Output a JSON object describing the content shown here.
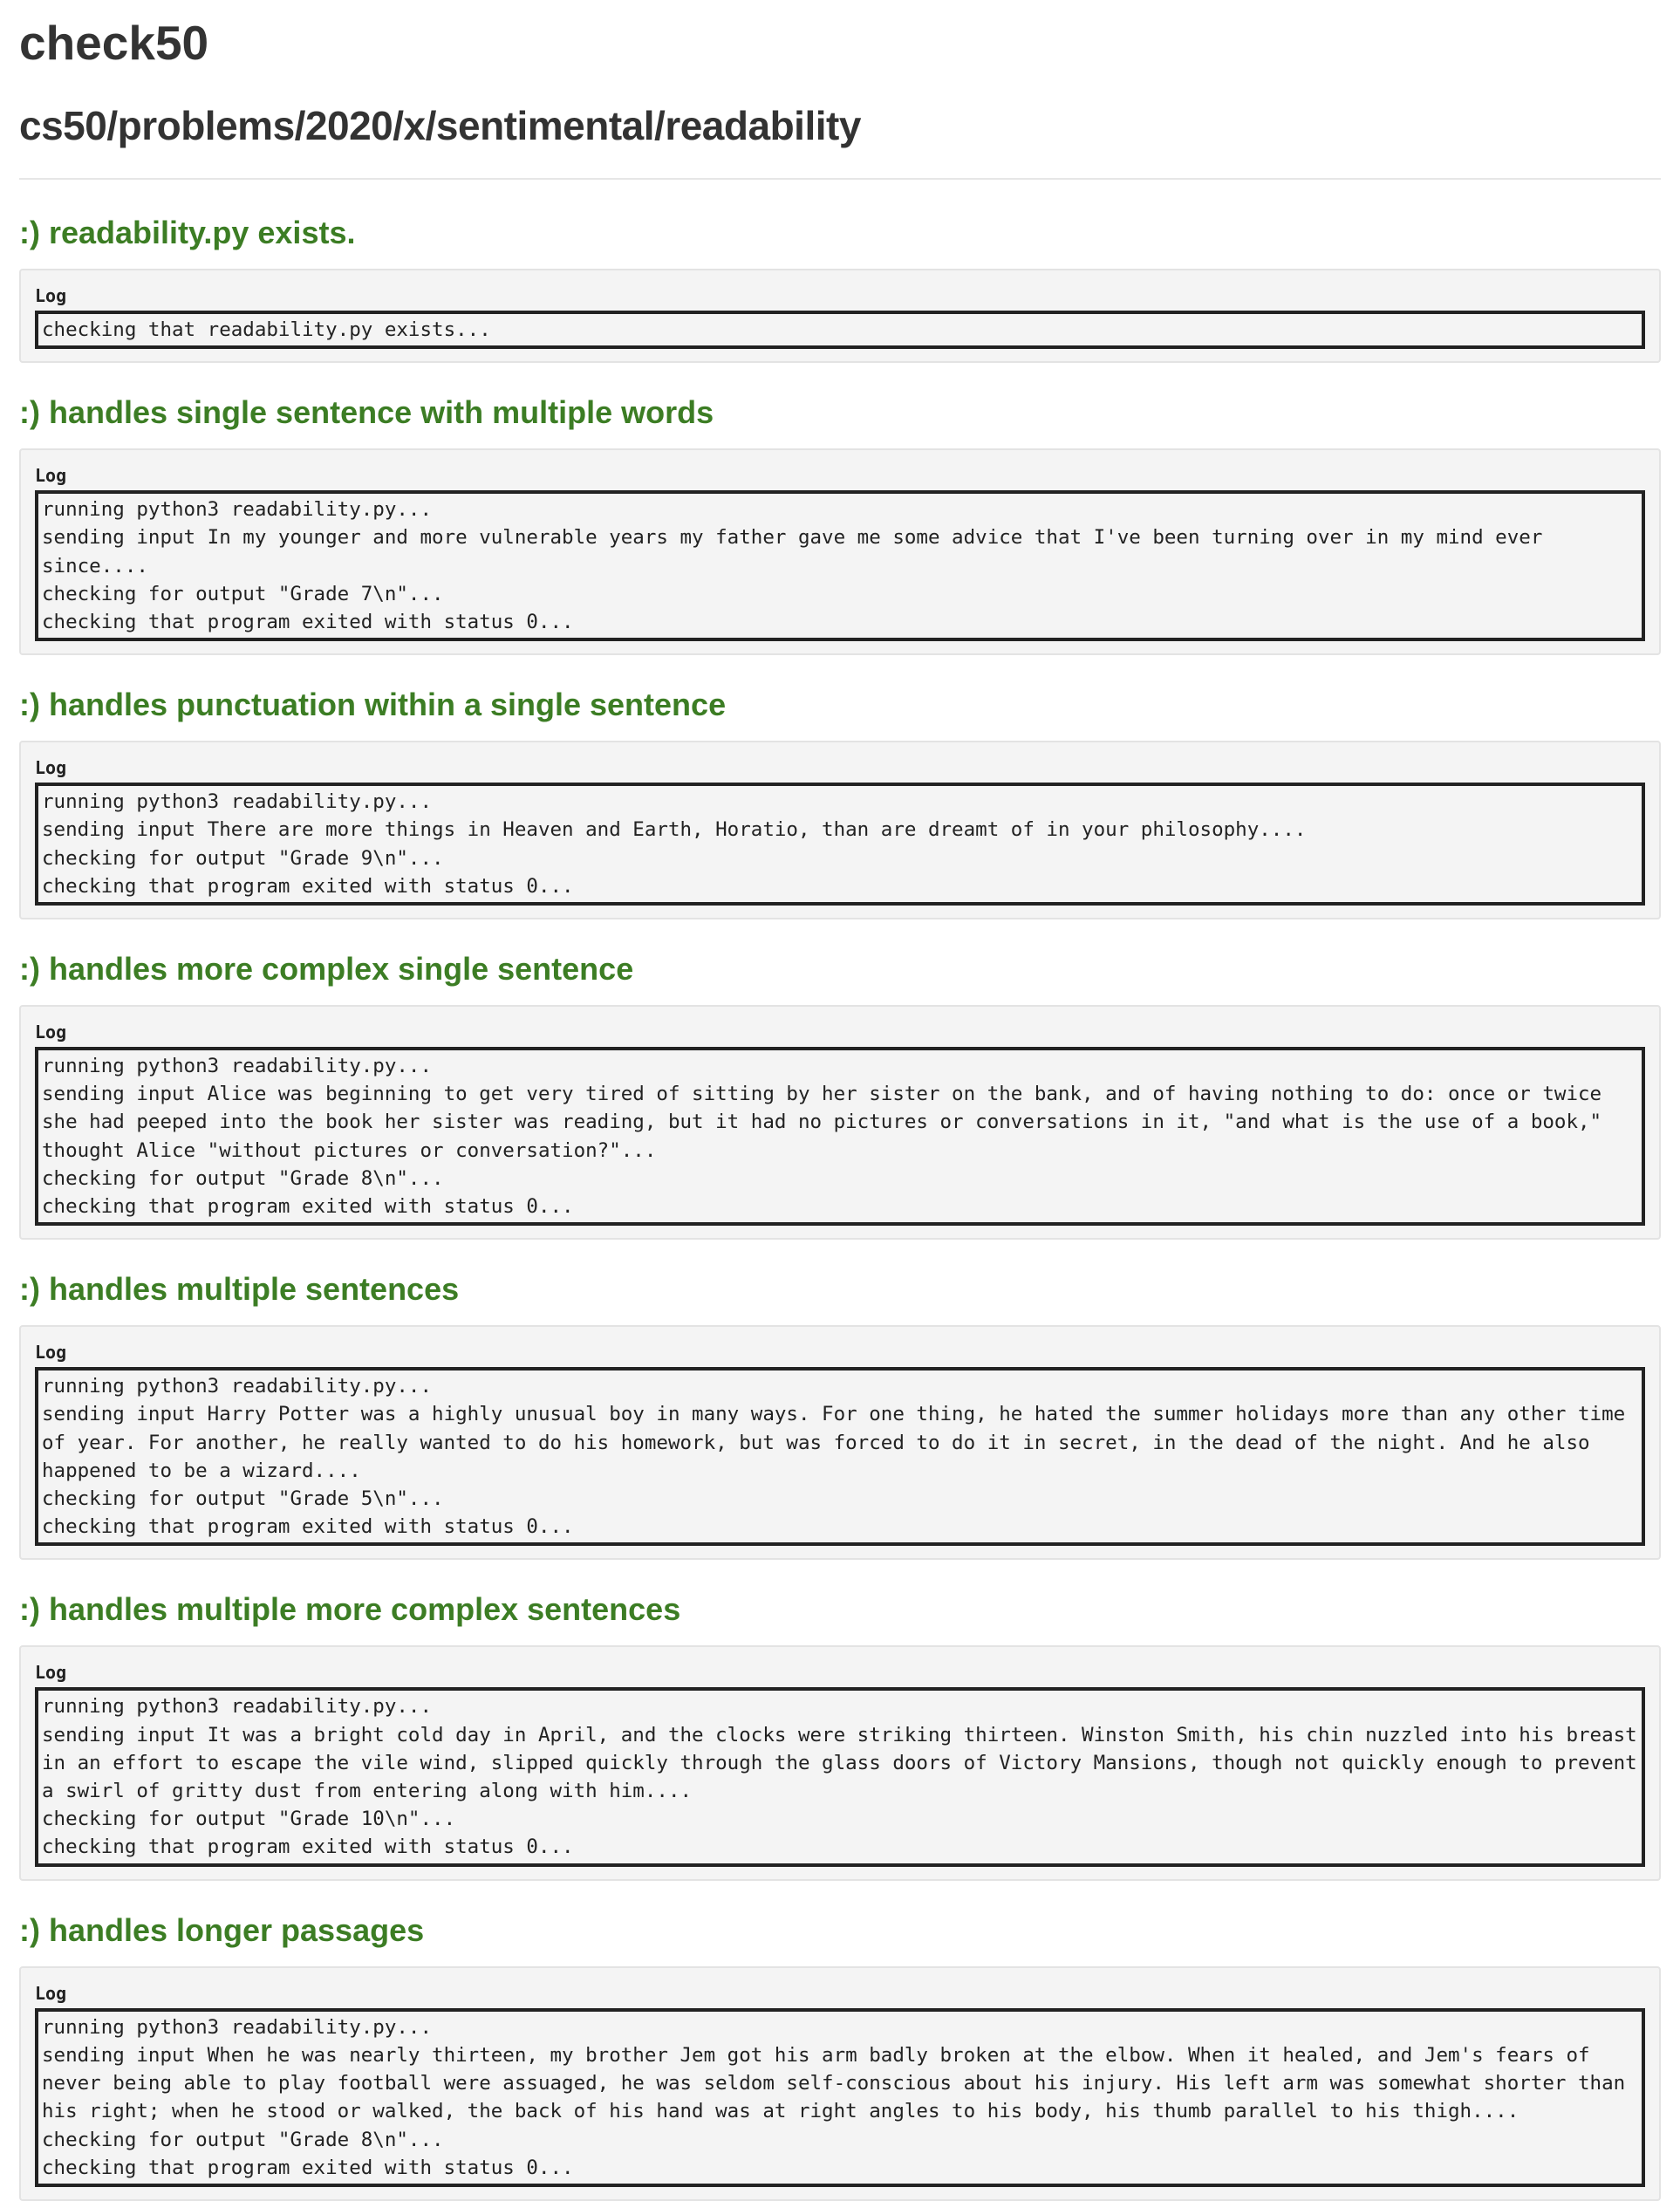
{
  "header": {
    "title": "check50",
    "slug": "cs50/problems/2020/x/sentimental/readability"
  },
  "log_label": "Log",
  "checks": [
    {
      "title": ":) readability.py exists.",
      "log": [
        "checking that readability.py exists..."
      ]
    },
    {
      "title": ":) handles single sentence with multiple words",
      "log": [
        "running python3 readability.py...",
        "sending input In my younger and more vulnerable years my father gave me some advice that I've been turning over in my mind ever since....",
        "checking for output \"Grade 7\\n\"...",
        "checking that program exited with status 0..."
      ]
    },
    {
      "title": ":) handles punctuation within a single sentence",
      "log": [
        "running python3 readability.py...",
        "sending input There are more things in Heaven and Earth, Horatio, than are dreamt of in your philosophy....",
        "checking for output \"Grade 9\\n\"...",
        "checking that program exited with status 0..."
      ]
    },
    {
      "title": ":) handles more complex single sentence",
      "log": [
        "running python3 readability.py...",
        "sending input Alice was beginning to get very tired of sitting by her sister on the bank, and of having nothing to do: once or twice she had peeped into the book her sister was reading, but it had no pictures or conversations in it, \"and what is the use of a book,\" thought Alice \"without pictures or conversation?\"...",
        "checking for output \"Grade 8\\n\"...",
        "checking that program exited with status 0..."
      ]
    },
    {
      "title": ":) handles multiple sentences",
      "log": [
        "running python3 readability.py...",
        "sending input Harry Potter was a highly unusual boy in many ways. For one thing, he hated the summer holidays more than any other time of year. For another, he really wanted to do his homework, but was forced to do it in secret, in the dead of the night. And he also happened to be a wizard....",
        "checking for output \"Grade 5\\n\"...",
        "checking that program exited with status 0..."
      ]
    },
    {
      "title": ":) handles multiple more complex sentences",
      "log": [
        "running python3 readability.py...",
        "sending input It was a bright cold day in April, and the clocks were striking thirteen. Winston Smith, his chin nuzzled into his breast in an effort to escape the vile wind, slipped quickly through the glass doors of Victory Mansions, though not quickly enough to prevent a swirl of gritty dust from entering along with him....",
        "checking for output \"Grade 10\\n\"...",
        "checking that program exited with status 0..."
      ]
    },
    {
      "title": ":) handles longer passages",
      "log": [
        "running python3 readability.py...",
        "sending input When he was nearly thirteen, my brother Jem got his arm badly broken at the elbow. When it healed, and Jem's fears of never being able to play football were assuaged, he was seldom self-conscious about his injury. His left arm was somewhat shorter than his right; when he stood or walked, the back of his hand was at right angles to his body, his thumb parallel to his thigh....",
        "checking for output \"Grade 8\\n\"...",
        "checking that program exited with status 0..."
      ]
    }
  ],
  "colors": {
    "pass": "#3c7d24",
    "text": "#333333",
    "well": "#f4f4f4"
  }
}
